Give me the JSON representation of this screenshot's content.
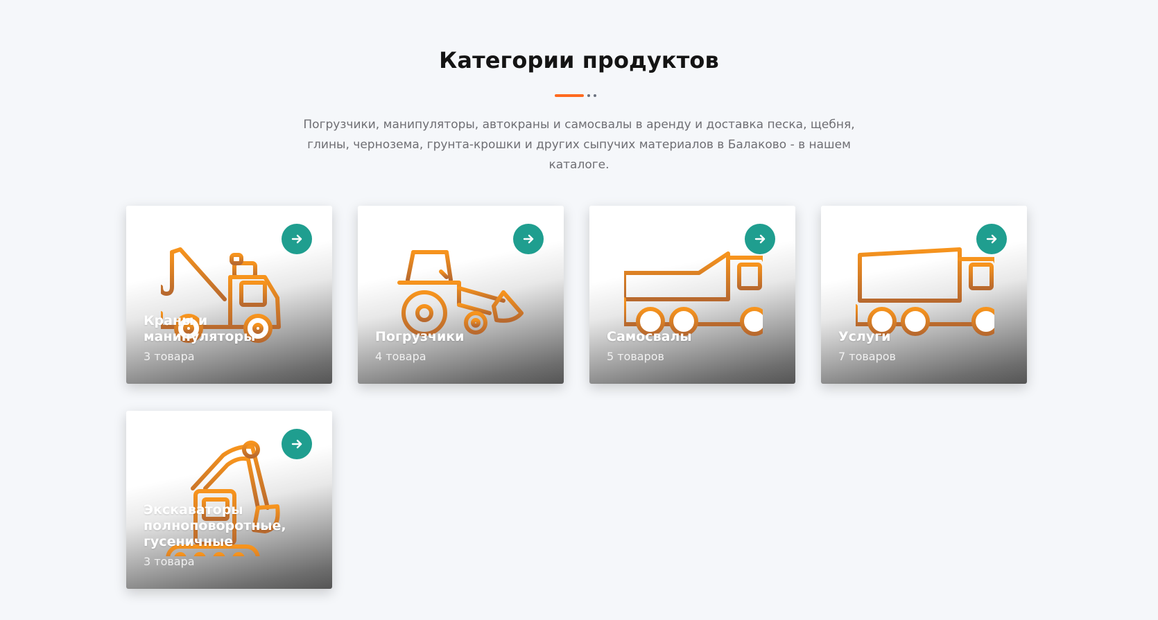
{
  "section": {
    "title": "Категории продуктов",
    "lead": "Погрузчики, манипуляторы, автокраны и самосвалы в аренду и доставка песка, щебня, глины, чернозема, грунта-крошки и других сыпучих материалов в Балаково - в нашем каталоге."
  },
  "colors": {
    "accent": "#ff6a1f",
    "button": "#1f9e8f",
    "icon_stroke_start": "#f7941d",
    "icon_stroke_end": "#b8692e"
  },
  "categories": [
    {
      "title": "Краны и манипуляторы",
      "count": "3 товара",
      "icon": "tow-crane-truck-icon"
    },
    {
      "title": "Погрузчики",
      "count": "4 товара",
      "icon": "wheel-loader-icon"
    },
    {
      "title": "Самосвалы",
      "count": "5 товаров",
      "icon": "dump-truck-icon"
    },
    {
      "title": "Услуги",
      "count": "7 товаров",
      "icon": "box-truck-icon"
    },
    {
      "title": "Экскаваторы полноповоротные, гусеничные",
      "count": "3 товара",
      "icon": "crawler-excavator-icon"
    }
  ]
}
